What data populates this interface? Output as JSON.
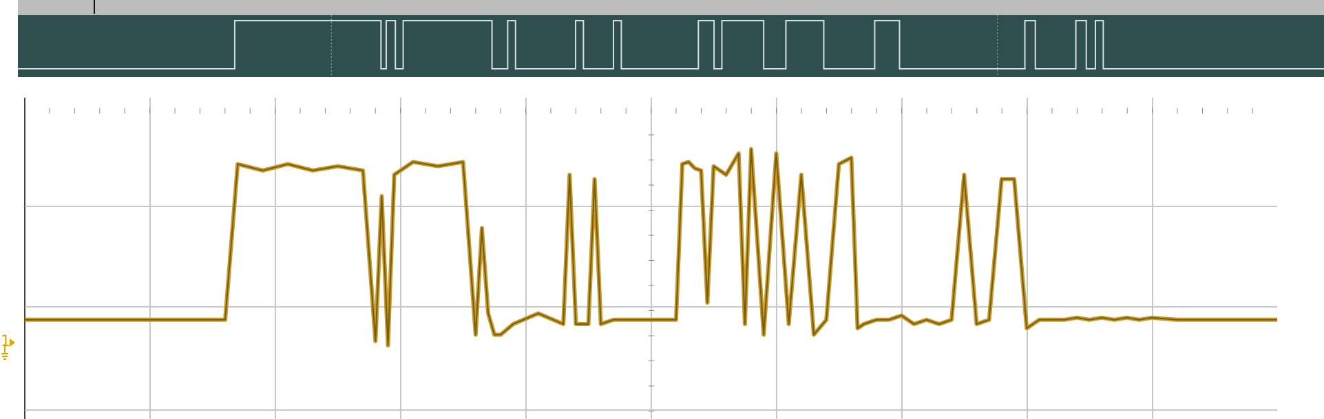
{
  "colors": {
    "digital_bg": "#2f4f4f",
    "digital_trace": "#d7dfe0",
    "analog_trace": "#7a5a10",
    "analog_trace_fill": "#c79b2a",
    "grid": "#c8c8c8",
    "ch1_marker": "#e1a300"
  },
  "channel": {
    "label": "1"
  },
  "icons": {
    "ch1_marker": "ground-arrow-icon"
  },
  "chart_data": {
    "type": "line",
    "digital_transitions": [
      {
        "x": 0.0,
        "level": 0
      },
      {
        "x": 0.166,
        "level": 1
      },
      {
        "x": 0.278,
        "level": 0
      },
      {
        "x": 0.282,
        "level": 1
      },
      {
        "x": 0.289,
        "level": 0
      },
      {
        "x": 0.295,
        "level": 1
      },
      {
        "x": 0.363,
        "level": 0
      },
      {
        "x": 0.375,
        "level": 1
      },
      {
        "x": 0.381,
        "level": 0
      },
      {
        "x": 0.427,
        "level": 1
      },
      {
        "x": 0.433,
        "level": 0
      },
      {
        "x": 0.456,
        "level": 1
      },
      {
        "x": 0.462,
        "level": 0
      },
      {
        "x": 0.521,
        "level": 1
      },
      {
        "x": 0.533,
        "level": 0
      },
      {
        "x": 0.539,
        "level": 1
      },
      {
        "x": 0.571,
        "level": 0
      },
      {
        "x": 0.588,
        "level": 1
      },
      {
        "x": 0.617,
        "level": 0
      },
      {
        "x": 0.656,
        "level": 1
      },
      {
        "x": 0.675,
        "level": 0
      },
      {
        "x": 0.771,
        "level": 1
      },
      {
        "x": 0.779,
        "level": 0
      },
      {
        "x": 0.81,
        "level": 1
      },
      {
        "x": 0.818,
        "level": 0
      },
      {
        "x": 0.825,
        "level": 1
      },
      {
        "x": 0.831,
        "level": 0
      },
      {
        "x": 1.0,
        "level": 0
      }
    ],
    "analog_series": [
      {
        "name": "",
        "x": [
          0.0,
          0.03,
          0.06,
          0.09,
          0.12,
          0.15,
          0.16,
          0.17,
          0.19,
          0.21,
          0.23,
          0.25,
          0.27,
          0.28,
          0.285,
          0.29,
          0.295,
          0.3,
          0.31,
          0.33,
          0.35,
          0.36,
          0.365,
          0.37,
          0.375,
          0.38,
          0.39,
          0.41,
          0.43,
          0.435,
          0.44,
          0.45,
          0.455,
          0.46,
          0.47,
          0.49,
          0.5,
          0.52,
          0.525,
          0.53,
          0.535,
          0.54,
          0.545,
          0.55,
          0.56,
          0.57,
          0.575,
          0.58,
          0.59,
          0.6,
          0.61,
          0.62,
          0.63,
          0.64,
          0.65,
          0.66,
          0.665,
          0.67,
          0.68,
          0.69,
          0.7,
          0.71,
          0.72,
          0.73,
          0.74,
          0.75,
          0.76,
          0.77,
          0.78,
          0.79,
          0.8,
          0.81,
          0.82,
          0.825,
          0.83,
          0.84,
          0.85,
          0.86,
          0.87,
          0.88,
          0.89,
          0.9,
          0.92,
          0.95,
          1.0
        ],
        "y": [
          0.12,
          0.12,
          0.12,
          0.12,
          0.12,
          0.12,
          0.12,
          0.85,
          0.82,
          0.85,
          0.82,
          0.84,
          0.82,
          0.02,
          0.7,
          0.0,
          0.8,
          0.82,
          0.86,
          0.84,
          0.86,
          0.05,
          0.55,
          0.15,
          0.05,
          0.05,
          0.1,
          0.15,
          0.1,
          0.8,
          0.1,
          0.1,
          0.78,
          0.1,
          0.12,
          0.12,
          0.12,
          0.12,
          0.85,
          0.86,
          0.83,
          0.82,
          0.2,
          0.84,
          0.8,
          0.9,
          0.1,
          0.92,
          0.05,
          0.9,
          0.1,
          0.8,
          0.05,
          0.12,
          0.85,
          0.88,
          0.08,
          0.1,
          0.12,
          0.12,
          0.14,
          0.1,
          0.12,
          0.1,
          0.12,
          0.8,
          0.1,
          0.12,
          0.78,
          0.78,
          0.08,
          0.12,
          0.12,
          0.12,
          0.12,
          0.13,
          0.12,
          0.13,
          0.12,
          0.13,
          0.12,
          0.13,
          0.12,
          0.12,
          0.12
        ]
      }
    ]
  }
}
